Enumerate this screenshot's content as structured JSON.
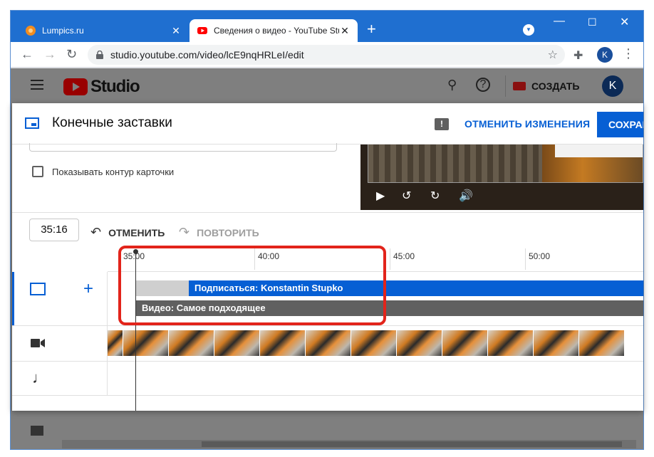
{
  "browser": {
    "tabs": [
      {
        "title": "Lumpics.ru",
        "favicon": "lumpics-favicon",
        "color": "#f28c1e"
      },
      {
        "title": "Сведения о видео - YouTube Studio",
        "favicon": "youtube-favicon",
        "color": "#ff0000"
      }
    ],
    "new_tab": "+",
    "url": "studio.youtube.com/video/lcE9nqHRLeI/edit",
    "profile_initial": "K"
  },
  "studio": {
    "logo_text": "Studio",
    "create_label": "СОЗДАТЬ",
    "avatar_initial": "K"
  },
  "modal": {
    "title": "Конечные заставки",
    "undo_changes": "ОТМЕНИТЬ ИЗМЕНЕНИЯ",
    "save": "СОХРАНИТЬ",
    "show_card_outline": "Показывать контур карточки",
    "current_time": "35:16",
    "undo": "ОТМЕНИТЬ",
    "redo": "ПОВТОРИТЬ",
    "ruler_labels": [
      "35:00",
      "40:00",
      "45:00",
      "50:00"
    ],
    "elements": [
      {
        "label": "Подписаться: Konstantin Stupko",
        "color": "#065fd4"
      },
      {
        "label": "Видео: Самое подходящее",
        "color": "#606060"
      }
    ],
    "accent_color": "#065fd4",
    "highlight_color": "#e2241b"
  }
}
